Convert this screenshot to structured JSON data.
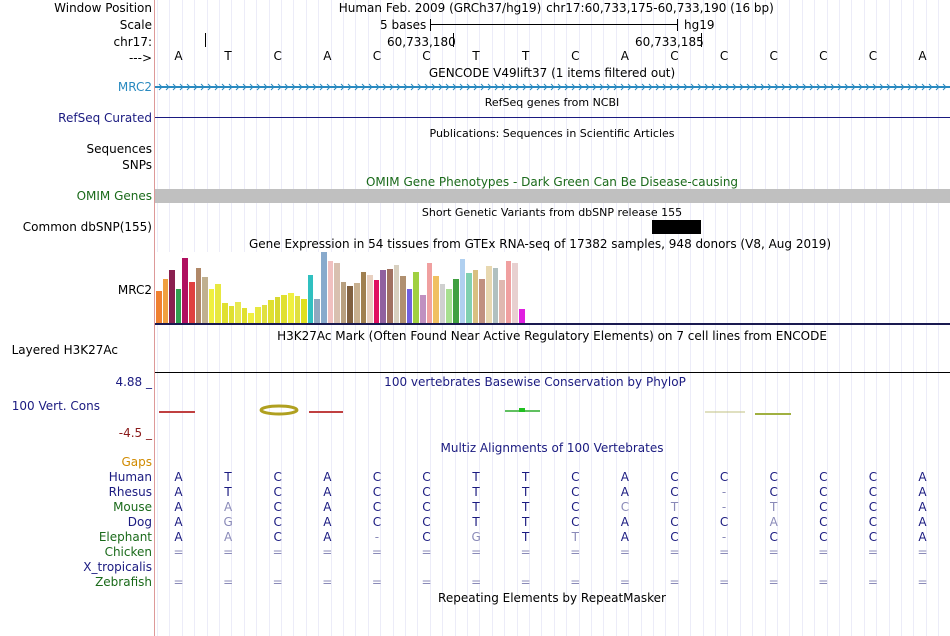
{
  "labels": {
    "window_position": "Window Position",
    "scale": "Scale",
    "chrom": "chr17:",
    "arrow": "--->",
    "mrc2_gene": "MRC2",
    "refseq": "RefSeq Curated",
    "sequences": "Sequences",
    "snps": "SNPs",
    "omim": "OMIM Genes",
    "common_dbsnp": "Common dbSNP(155)",
    "gtex_gene": "MRC2",
    "h3k27ac": "Layered H3K27Ac",
    "cons_max": "4.88 _",
    "cons_name": "100 Vert. Cons",
    "cons_min": "-4.5 _",
    "gaps": "Gaps"
  },
  "header": {
    "assembly": "Human Feb. 2009 (GRCh37/hg19)",
    "position": "chr17:60,733,175-60,733,190 (16 bp)",
    "scale_text": "5 bases",
    "scale_db": "hg19",
    "coord_1": "60,733,180",
    "coord_2": "60,733,185"
  },
  "bases": [
    "A",
    "T",
    "C",
    "A",
    "C",
    "C",
    "T",
    "T",
    "C",
    "A",
    "C",
    "C",
    "C",
    "C",
    "C",
    "A"
  ],
  "track_titles": {
    "gencode": "GENCODE V49lift37 (1 items filtered out)",
    "refseq": "RefSeq genes from NCBI",
    "publications": "Publications: Sequences in Scientific Articles",
    "omim": "OMIM Gene Phenotypes - Dark Green Can Be Disease-causing",
    "dbsnp": "Short Genetic Variants from dbSNP release 155",
    "gtex": "Gene Expression in 54 tissues from GTEx RNA-seq of 17382 samples, 948 donors (V8, Aug 2019)",
    "h3k27ac": "H3K27Ac Mark (Often Found Near Active Regulatory Elements) on 7 cell lines from ENCODE",
    "phylop": "100 vertebrates Basewise Conservation by PhyloP",
    "multiz": "Multiz Alignments of 100 Vertebrates",
    "repeatmasker": "Repeating Elements by RepeatMasker"
  },
  "species": [
    {
      "name": "Human",
      "color": "#1a1a80",
      "row": [
        "A",
        "T",
        "C",
        "A",
        "C",
        "C",
        "T",
        "T",
        "C",
        "A",
        "C",
        "C",
        "C",
        "C",
        "C",
        "A"
      ]
    },
    {
      "name": "Rhesus",
      "color": "#1a1a80",
      "row": [
        "A",
        "T",
        "C",
        "A",
        "C",
        "C",
        "T",
        "T",
        "C",
        "A",
        "C",
        "-",
        "C",
        "C",
        "C",
        "A"
      ]
    },
    {
      "name": "Mouse",
      "color": "#1a6a1a",
      "row": [
        "A",
        "A",
        "C",
        "A",
        "C",
        "C",
        "T",
        "T",
        "C",
        "C",
        "T",
        "-",
        "T",
        "C",
        "C",
        "A"
      ]
    },
    {
      "name": "Dog",
      "color": "#1a1a80",
      "row": [
        "A",
        "G",
        "C",
        "A",
        "C",
        "C",
        "T",
        "T",
        "C",
        "A",
        "C",
        "C",
        "A",
        "C",
        "C",
        "A"
      ]
    },
    {
      "name": "Elephant",
      "color": "#1a6a1a",
      "row": [
        "A",
        "A",
        "C",
        "A",
        "-",
        "C",
        "G",
        "T",
        "T",
        "A",
        "C",
        "-",
        "C",
        "C",
        "C",
        "A"
      ]
    },
    {
      "name": "Chicken",
      "color": "#1a6a1a",
      "row": [
        "=",
        "=",
        "=",
        "=",
        "=",
        "=",
        "=",
        "=",
        "=",
        "=",
        "=",
        "=",
        "=",
        "=",
        "=",
        "="
      ]
    },
    {
      "name": "X_tropicalis",
      "color": "#1a1a80",
      "row": [
        "",
        "",
        "",
        "",
        "",
        "",
        "",
        "",
        "",
        "",
        "",
        "",
        "",
        "",
        "",
        ""
      ]
    },
    {
      "name": "Zebrafish",
      "color": "#1a6a1a",
      "row": [
        "=",
        "=",
        "=",
        "=",
        "=",
        "=",
        "=",
        "=",
        "=",
        "=",
        "=",
        "=",
        "=",
        "=",
        "=",
        "="
      ]
    }
  ],
  "gtex_values": [
    0.45,
    0.62,
    0.74,
    0.48,
    0.92,
    0.58,
    0.78,
    0.65,
    0.48,
    0.55,
    0.28,
    0.24,
    0.3,
    0.21,
    0.14,
    0.22,
    0.26,
    0.32,
    0.36,
    0.4,
    0.42,
    0.38,
    0.34,
    0.68,
    0.34,
    1.0,
    0.88,
    0.84,
    0.58,
    0.52,
    0.56,
    0.72,
    0.68,
    0.6,
    0.74,
    0.76,
    0.82,
    0.66,
    0.48,
    0.72,
    0.4,
    0.84,
    0.66,
    0.55,
    0.48,
    0.62,
    0.9,
    0.7,
    0.74,
    0.62,
    0.8,
    0.78,
    0.6,
    0.88,
    0.84,
    0.2
  ],
  "gtex_colors": [
    "#f08030",
    "#f0a040",
    "#8a2050",
    "#30a050",
    "#b01060",
    "#e04040",
    "#b08868",
    "#c0b090",
    "#f0f040",
    "#e8e840",
    "#e0e030",
    "#e0e030",
    "#e8e850",
    "#e0e030",
    "#f0f040",
    "#e8e840",
    "#e0e040",
    "#e0e030",
    "#d8d830",
    "#e0e030",
    "#f0f040",
    "#e0e040",
    "#e0e020",
    "#30c0c0",
    "#90a8c0",
    "#88aacc",
    "#f0c0c0",
    "#d8c0b0",
    "#b8a080",
    "#806040",
    "#c8b090",
    "#a08050",
    "#e8d0c0",
    "#e01060",
    "#9060a0",
    "#a07060",
    "#d8d0c0",
    "#b09070",
    "#7060e0",
    "#a0d040",
    "#c090c0",
    "#f0a0a0",
    "#f0c060",
    "#d0d0d0",
    "#a8e090",
    "#40a040",
    "#b0d0f0",
    "#80d0b0",
    "#d8c080",
    "#c09080",
    "#e8d8b0",
    "#b0c0c0",
    "#e0b8b0",
    "#f0a0a0",
    "#e8d0d0",
    "#e020e0"
  ]
}
